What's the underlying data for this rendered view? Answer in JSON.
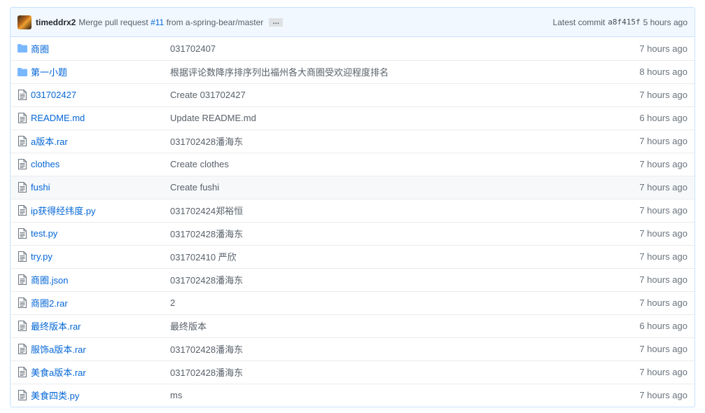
{
  "commit": {
    "author": "timeddrx2",
    "message_prefix": "Merge pull request",
    "pr": "#11",
    "message_suffix": "from a-spring-bear/master",
    "ellipsis": "…",
    "latest_label": "Latest commit",
    "sha": "a8f415f",
    "age": "5 hours ago"
  },
  "files": [
    {
      "type": "dir",
      "name": "商圈",
      "message": "031702407",
      "age": "7 hours ago"
    },
    {
      "type": "dir",
      "name": "第一小题",
      "message": "根据评论数降序排序列出福州各大商圈受欢迎程度排名",
      "age": "8 hours ago"
    },
    {
      "type": "file",
      "name": "031702427",
      "message": "Create 031702427",
      "age": "7 hours ago"
    },
    {
      "type": "file",
      "name": "README.md",
      "message": "Update README.md",
      "age": "6 hours ago"
    },
    {
      "type": "file",
      "name": "a版本.rar",
      "message": "031702428潘海东",
      "age": "7 hours ago"
    },
    {
      "type": "file",
      "name": "clothes",
      "message": "Create clothes",
      "age": "7 hours ago"
    },
    {
      "type": "file",
      "name": "fushi",
      "message": "Create fushi",
      "age": "7 hours ago"
    },
    {
      "type": "file",
      "name": "ip获得经纬度.py",
      "message": "031702424郑裕恒",
      "age": "7 hours ago"
    },
    {
      "type": "file",
      "name": "test.py",
      "message": "031702428潘海东",
      "age": "7 hours ago"
    },
    {
      "type": "file",
      "name": "try.py",
      "message": "031702410 严欣",
      "age": "7 hours ago"
    },
    {
      "type": "file",
      "name": "商圈.json",
      "message": "031702428潘海东",
      "age": "7 hours ago"
    },
    {
      "type": "file",
      "name": "商圈2.rar",
      "message": "2",
      "age": "7 hours ago"
    },
    {
      "type": "file",
      "name": "最终版本.rar",
      "message": "最终版本",
      "age": "6 hours ago"
    },
    {
      "type": "file",
      "name": "服饰a版本.rar",
      "message": "031702428潘海东",
      "age": "7 hours ago"
    },
    {
      "type": "file",
      "name": "美食a版本.rar",
      "message": "031702428潘海东",
      "age": "7 hours ago"
    },
    {
      "type": "file",
      "name": "美食四类.py",
      "message": "ms",
      "age": "7 hours ago"
    }
  ],
  "colors": {
    "link": "#0366d6",
    "folder_icon": "#79b8ff",
    "file_icon": "#6a737d",
    "commit_bar_bg": "#f1f8ff",
    "border": "#c8e1ff"
  },
  "hover_row_index": 6
}
